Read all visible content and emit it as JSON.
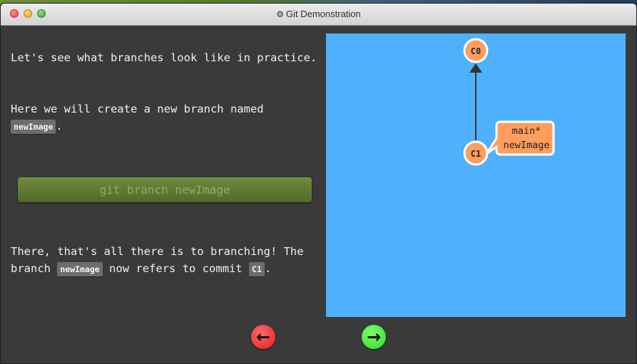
{
  "window": {
    "title": "Git Demonstration"
  },
  "lesson": {
    "intro_line": "Let's see what branches look like in practice.",
    "create_prefix": "Here we will create a new branch named ",
    "branch_name": "newImage",
    "create_suffix": ".",
    "command": "git branch newImage",
    "result_prefix": "There, that's all there is to branching! The branch ",
    "result_branch": "newImage",
    "result_middle": " now refers to commit ",
    "result_commit": "C1",
    "result_suffix": "."
  },
  "graph": {
    "commits": [
      {
        "id": "C0",
        "label": "C0"
      },
      {
        "id": "C1",
        "label": "C1"
      }
    ],
    "branch_label": {
      "line1": "main*",
      "line2": "newImage"
    },
    "colors": {
      "background": "#4fb1fc",
      "commit_fill": "#ff9e5e",
      "commit_stroke": "#ffffff",
      "edge": "#333333"
    }
  },
  "nav": {
    "prev_icon": "left-arrow-icon",
    "next_icon": "right-arrow-icon",
    "prev_glyph": "←",
    "next_glyph": "→",
    "prev_color": "#e51b1b",
    "next_color": "#2fd62a"
  }
}
